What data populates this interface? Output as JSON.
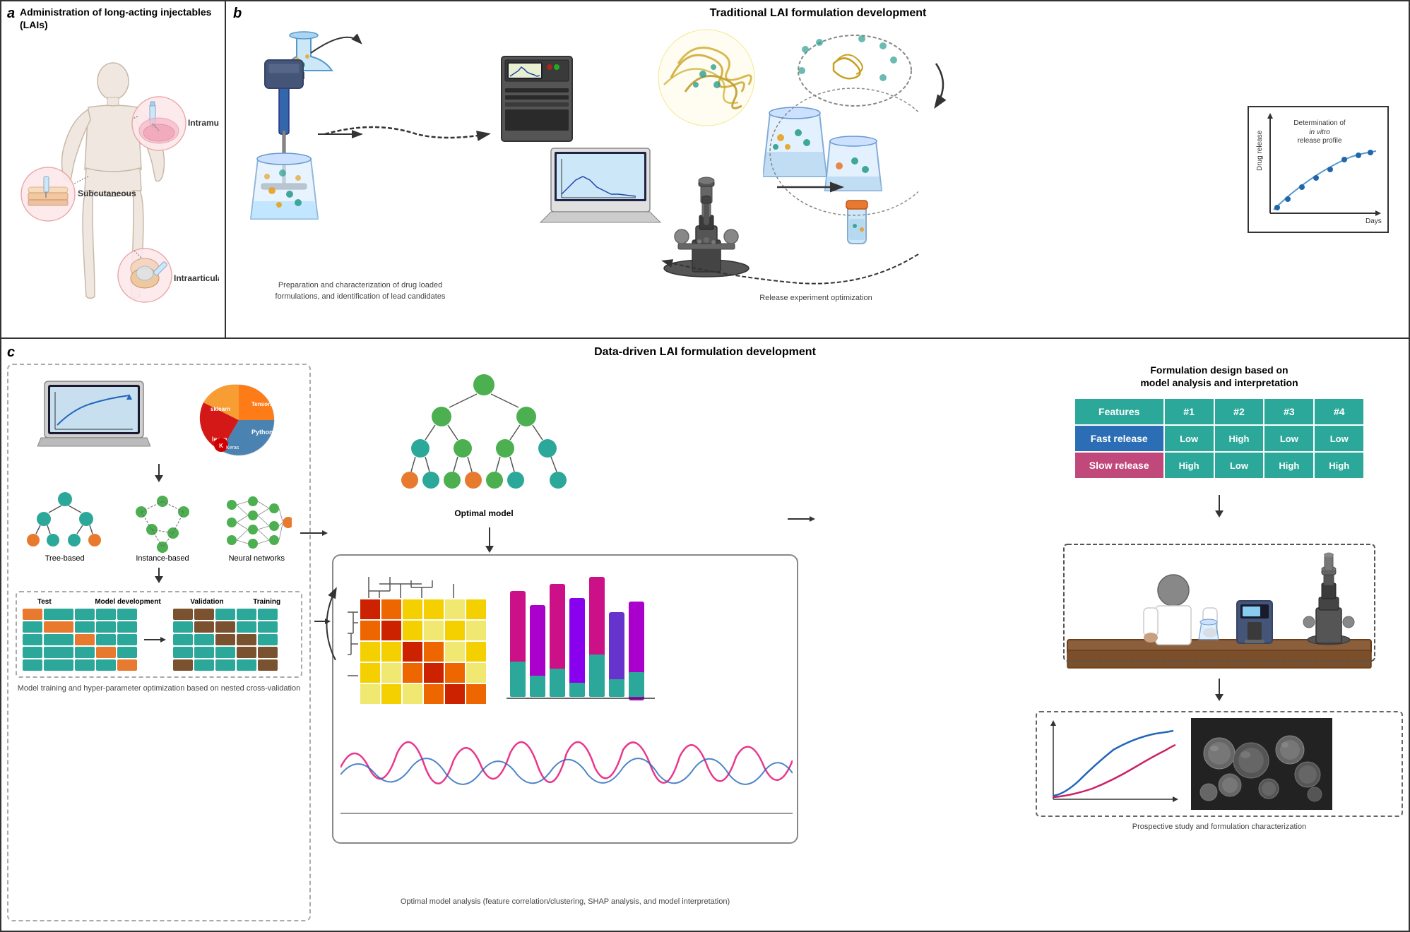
{
  "panels": {
    "a": {
      "letter": "a",
      "title": "Administration of long-acting injectables (LAIs)",
      "injection_sites": [
        {
          "label": "Intramuscular",
          "color": "#f5c6cb"
        },
        {
          "label": "Subcutaneous",
          "color": "#f5c6cb"
        },
        {
          "label": "Intraarticular",
          "color": "#f5c6cb"
        }
      ]
    },
    "b": {
      "letter": "b",
      "title": "Traditional LAI formulation development",
      "steps": [
        {
          "id": "preparation",
          "label": "Preparation and characterization of drug loaded formulations, and identification of lead candidates"
        },
        {
          "id": "release",
          "label": "Release experiment optimization"
        },
        {
          "id": "determination",
          "label": "Determination of in vitro release profile"
        }
      ],
      "chart": {
        "x_label": "Days",
        "y_label": "Drug release",
        "title": "in vitro"
      }
    },
    "c": {
      "letter": "c",
      "title": "Data-driven LAI formulation development",
      "left": {
        "model_types": [
          {
            "label": "Tree-based"
          },
          {
            "label": "Instance-based"
          },
          {
            "label": "Neural networks"
          }
        ],
        "cv_labels": [
          "Test",
          "Model development",
          "Validation",
          "Training"
        ],
        "bottom_label": "Model training and hyper-parameter optimization based on nested cross-validation"
      },
      "middle": {
        "optimal_label": "Optimal model",
        "analysis_label": "Optimal model analysis (feature correlation/clustering, SHAP analysis, and model interpretation)"
      },
      "right": {
        "section_title": "Formulation design based on model analysis and interpretation",
        "table": {
          "headers": [
            "Features",
            "#1",
            "#2",
            "#3",
            "#4"
          ],
          "rows": [
            {
              "label": "Fast release",
              "values": [
                "Low",
                "High",
                "Low",
                "Low"
              ]
            },
            {
              "label": "Slow release",
              "values": [
                "High",
                "Low",
                "High",
                "High"
              ]
            }
          ]
        },
        "bottom_label": "Prospective study and formulation characterization"
      }
    }
  },
  "colors": {
    "teal": "#2ca89a",
    "blue": "#2c6eb5",
    "pink": "#c0487a",
    "orange": "#e87a30",
    "green": "#4caf50",
    "dark_green": "#2e7d32",
    "border": "#333333",
    "light_gray": "#cccccc"
  }
}
